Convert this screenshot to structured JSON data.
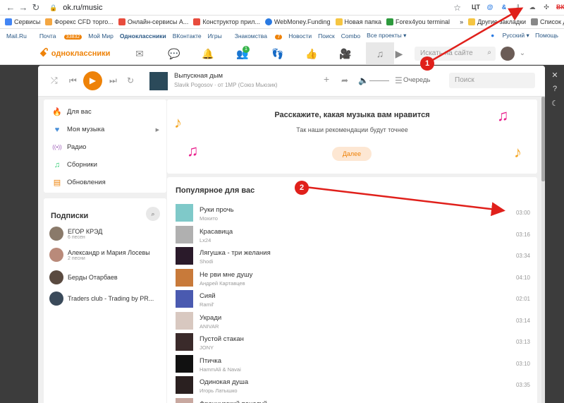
{
  "browser": {
    "url": "ok.ru/music",
    "extensions": [
      "ЦТ",
      "@",
      "&",
      "",
      "",
      "ВК"
    ],
    "bookmarks": [
      {
        "label": "Сервисы",
        "color": "#4285f4"
      },
      {
        "label": "Форекс CFD торго...",
        "color": "#f4a742"
      },
      {
        "label": "Онлайн-сервисы А...",
        "color": "#e84c3d"
      },
      {
        "label": "Конструктор прил...",
        "color": "#e84c3d"
      },
      {
        "label": "WebMoney.Funding",
        "color": "#2a7ae2"
      },
      {
        "label": "Новая папка",
        "color": "#f5c542"
      },
      {
        "label": "Forex4you terminal",
        "color": "#2d9a3d"
      },
      {
        "label": "»",
        "color": ""
      },
      {
        "label": "Другие закладки",
        "color": "#f5c542"
      },
      {
        "label": "Список для чтения",
        "color": "#888"
      }
    ]
  },
  "oklinks": {
    "items": [
      "Mail.Ru",
      "Почта",
      "Мой Мир",
      "Одноклассники",
      "ВКонтакте",
      "Игры",
      "Знакомства",
      "Новости",
      "Поиск",
      "Combo",
      "Все проекты ▾"
    ],
    "mail_badge": "33832",
    "znak_badge": "7",
    "lang": "Русский ▾",
    "help": "Помощь"
  },
  "okheader": {
    "logo": "одноклассники",
    "friends_badge": "1",
    "search_placeholder": "Искать на сайте"
  },
  "player": {
    "title": "Выпускная дым",
    "artist": "Slavik Pogosov · от 1МР (Союз Мьюзик)",
    "queue": "Очередь",
    "search_placeholder": "Поиск"
  },
  "sidebar": {
    "menu": [
      {
        "label": "Для вас",
        "icon": "flame-icon",
        "glyph": "🔥",
        "color": "#ee8208"
      },
      {
        "label": "Моя музыка",
        "icon": "heart-icon",
        "glyph": "💙",
        "color": "#4a90d9"
      },
      {
        "label": "Радио",
        "icon": "radio-icon",
        "glyph": "((•))",
        "color": "#9b59b6"
      },
      {
        "label": "Сборники",
        "icon": "collection-icon",
        "glyph": "♫",
        "color": "#2ecc71"
      },
      {
        "label": "Обновления",
        "icon": "updates-icon",
        "glyph": "▤",
        "color": "#ee8208"
      }
    ],
    "subs_title": "Подписки",
    "subscriptions": [
      {
        "name": "ЕГОР КРЭД",
        "count": "6 песен",
        "color": "#8a7a6a"
      },
      {
        "name": "Александр и Мария Лосевы",
        "count": "2 песни",
        "color": "#b98a7a"
      },
      {
        "name": "Берды Отарбаев",
        "count": "",
        "color": "#5a4a40"
      },
      {
        "name": "Traders club - Trading by PR...",
        "count": "",
        "color": "#3a4a5a"
      }
    ]
  },
  "banner": {
    "title": "Расскажите, какая музыка вам нравится",
    "subtitle": "Так наши рекомендации будут точнее",
    "button": "Далее"
  },
  "popular": {
    "title": "Популярное для вас",
    "tracks": [
      {
        "title": "Руки прочь",
        "artist": "Мохито",
        "duration": "03:00",
        "color": "#7fc9c9"
      },
      {
        "title": "Красавица",
        "artist": "Lx24",
        "duration": "03:16",
        "color": "#b0b0b0"
      },
      {
        "title": "Лягушка - три желания",
        "artist": "Shodi",
        "duration": "03:34",
        "color": "#2a1a2a"
      },
      {
        "title": "Не рви мне душу",
        "artist": "Андрей Картавцев",
        "duration": "04:10",
        "color": "#c87a3a"
      },
      {
        "title": "Сияй",
        "artist": "Ramil'",
        "duration": "02:01",
        "color": "#4a5ab0"
      },
      {
        "title": "Укради",
        "artist": "ANIVAR",
        "duration": "03:14",
        "color": "#d8c8c0"
      },
      {
        "title": "Пустой стакан",
        "artist": "JONY",
        "duration": "03:13",
        "color": "#3a2a2a"
      },
      {
        "title": "Птичка",
        "artist": "HammAli & Navai",
        "duration": "03:10",
        "color": "#111111"
      },
      {
        "title": "Одинокая душа",
        "artist": "Игорь Латышко",
        "duration": "03:35",
        "color": "#2a2020"
      },
      {
        "title": "Французский поцелуй",
        "artist": "",
        "duration": "",
        "color": "#c8a8a0"
      }
    ]
  },
  "annotations": {
    "one": "1",
    "two": "2",
    "color": "#e0201b"
  }
}
